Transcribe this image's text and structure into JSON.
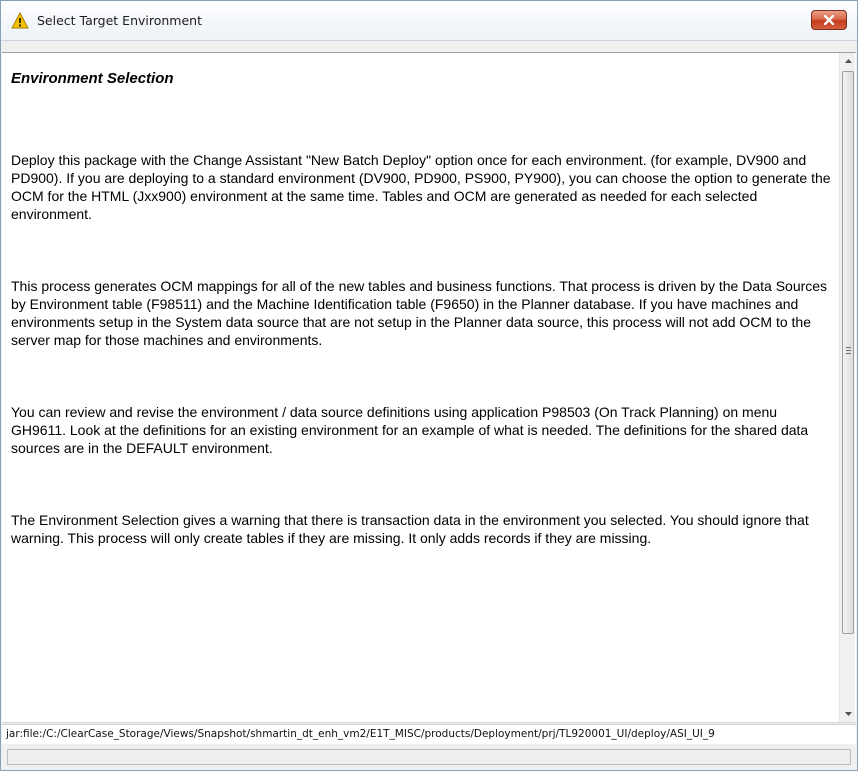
{
  "window": {
    "title": "Select Target Environment"
  },
  "icons": {
    "title_icon": "warning-icon",
    "close": "close-icon",
    "scroll_up": "arrow-up-icon",
    "scroll_down": "arrow-down-icon"
  },
  "colors": {
    "close_button": "#c5391c",
    "warning_icon": "#f2c100"
  },
  "content": {
    "heading": "Environment Selection",
    "paragraphs": [
      "Deploy this package with the Change Assistant \"New Batch Deploy\" option once for each environment. (for example, DV900 and PD900).  If you are deploying to a standard environment (DV900, PD900, PS900, PY900), you can choose the option to generate the OCM for the HTML (Jxx900) environment at the same time.  Tables and OCM are generated as needed for each selected environment.",
      "This process generates OCM mappings for all of the new tables and business functions.  That process is driven by the Data Sources by Environment table (F98511) and the Machine Identification table (F9650) in the Planner database.  If you have machines and environments setup in the System data source that are not setup in the Planner data source, this process will not add OCM to the server map for those machines and environments.",
      "You can review and revise the environment / data source definitions using application P98503 (On Track Planning) on menu GH9611.  Look at the definitions for an existing environment for an example of what is needed.  The definitions for the shared data sources are in the DEFAULT environment.",
      "The Environment Selection gives a warning that there is transaction data in the environment you selected.  You should ignore that warning.  This process will only create tables if they are missing.  It only adds records if they are missing."
    ]
  },
  "status": {
    "path": "jar:file:/C:/ClearCase_Storage/Views/Snapshot/shmartin_dt_enh_vm2/E1T_MISC/products/Deployment/prj/TL920001_UI/deploy/ASI_UI_9"
  }
}
